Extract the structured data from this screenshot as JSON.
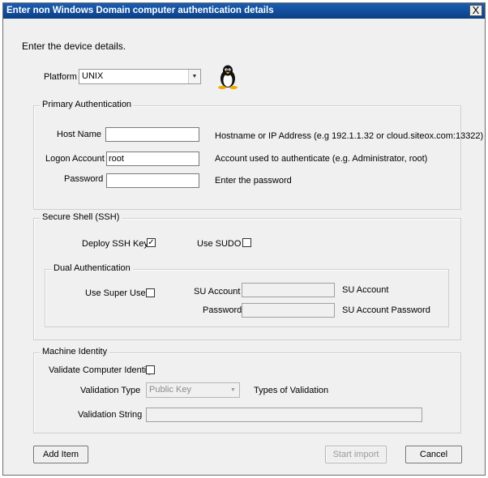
{
  "window": {
    "title": "Enter non Windows Domain computer authentication details",
    "close_label": "X"
  },
  "intro": "Enter the device details.",
  "platform": {
    "label": "Platform",
    "value": "UNIX",
    "icon": "linux-penguin-icon"
  },
  "primary": {
    "title": "Primary Authentication",
    "host_label": "Host Name",
    "host_value": "",
    "host_hint": "Hostname or IP Address (e.g 192.1.1.32 or cloud.siteox.com:13322)",
    "logon_label": "Logon Account",
    "logon_value": "root",
    "logon_hint": "Account used to authenticate (e.g. Administrator, root)",
    "password_label": "Password",
    "password_value": "",
    "password_hint": "Enter the password"
  },
  "ssh": {
    "title": "Secure Shell (SSH)",
    "deploy_label": "Deploy SSH Key",
    "deploy_checked": "✓",
    "sudo_label": "Use SUDO",
    "sudo_checked": "",
    "dual": {
      "title": "Dual Authentication",
      "super_label": "Use Super User",
      "super_checked": "",
      "su_account_label": "SU Account",
      "su_account_value": "",
      "su_account_hint": "SU Account",
      "su_password_label": "Password",
      "su_password_value": "",
      "su_password_hint": "SU Account Password"
    }
  },
  "identity": {
    "title": "Machine Identity",
    "validate_label": "Validate Computer Identity",
    "validate_checked": "",
    "type_label": "Validation Type",
    "type_value": "Public Key",
    "type_hint": "Types of Validation",
    "string_label": "Validation String",
    "string_value": ""
  },
  "buttons": {
    "add": "Add Item",
    "start": "Start import",
    "cancel": "Cancel"
  }
}
